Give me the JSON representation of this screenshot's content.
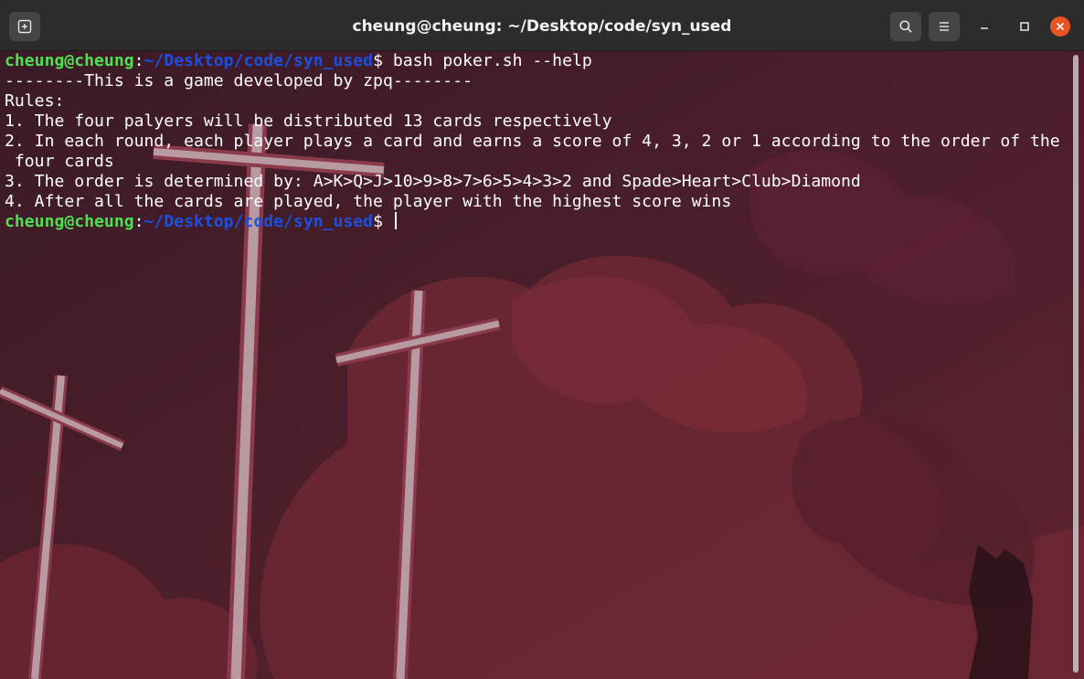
{
  "window": {
    "title": "cheung@cheung: ~/Desktop/code/syn_used",
    "icons": {
      "new_tab": "new-tab-icon",
      "search": "search-icon",
      "menu": "hamburger-menu-icon",
      "minimize": "minimize-icon",
      "maximize": "maximize-icon",
      "close": "close-icon"
    },
    "close_color": "#e95420"
  },
  "terminal": {
    "prompt_user": "cheung@cheung",
    "prompt_sep": ":",
    "prompt_path": "~/Desktop/code/syn_used",
    "prompt_symbol": "$ ",
    "command": "bash poker.sh --help",
    "output": [
      "--------This is a game developed by zpq--------",
      "Rules:",
      "1. The four palyers will be distributed 13 cards respectively",
      "2. In each round, each player plays a card and earns a score of 4, 3, 2 or 1 according to the order of the",
      " four cards",
      "3. The order is determined by: A>K>Q>J>10>9>8>7>6>5>4>3>2 and Spade>Heart>Club>Diamond",
      "4. After all the cards are played, the player with the highest score wins"
    ],
    "colors": {
      "user": "#4ee04e",
      "path": "#1c4fe0",
      "text": "#ffffff",
      "background": "#3a1a22"
    }
  }
}
